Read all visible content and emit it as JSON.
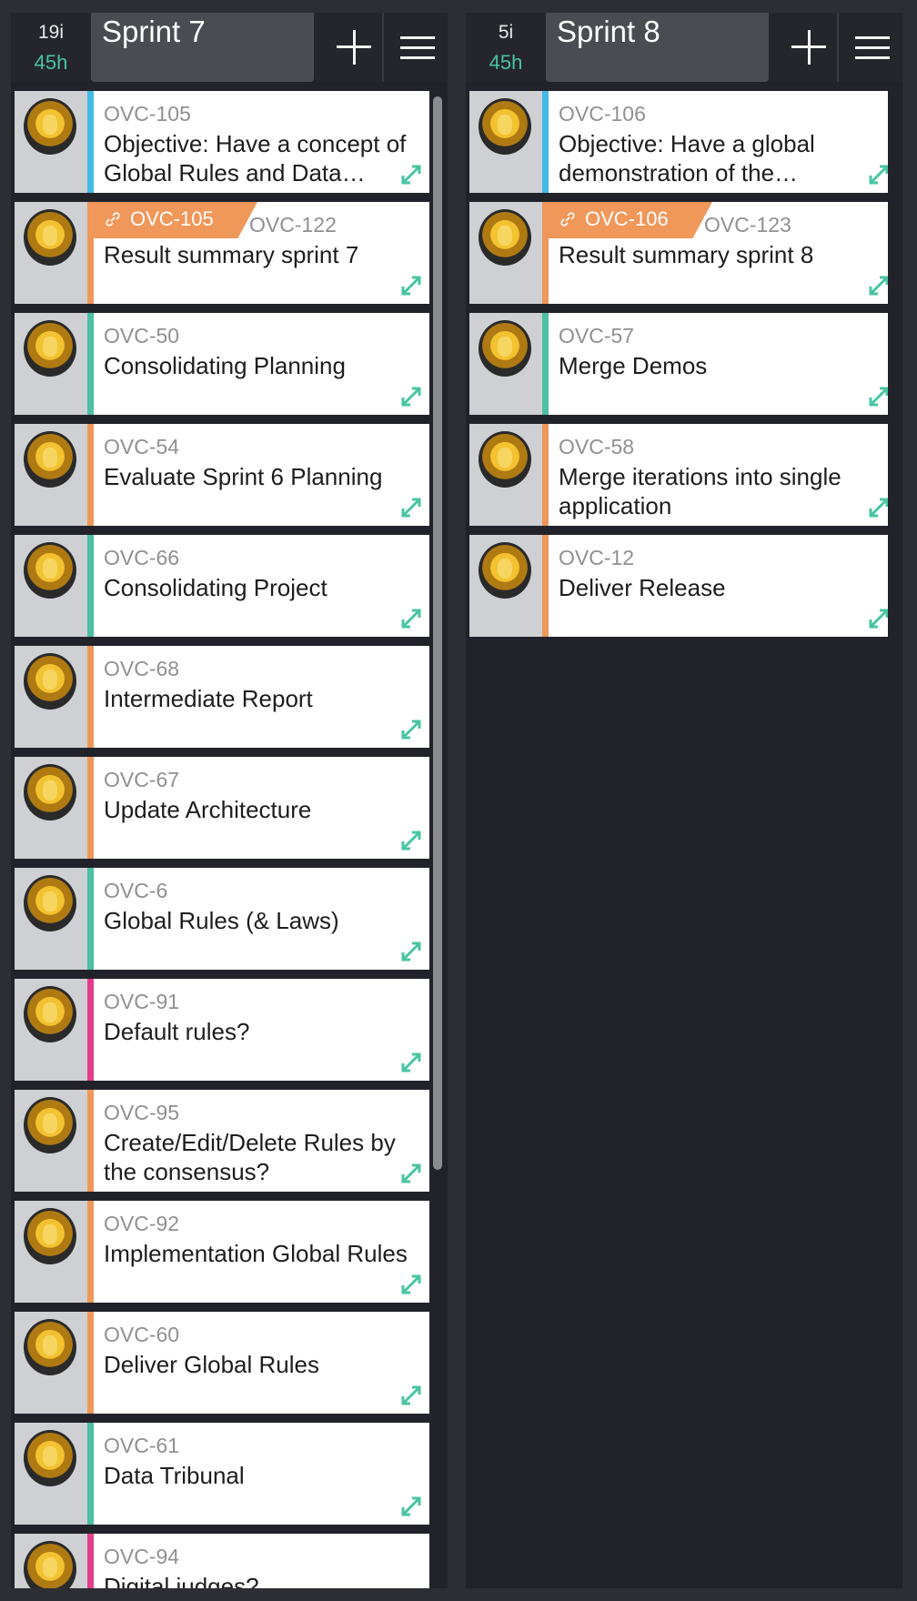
{
  "columns": [
    {
      "item_count": "19i",
      "hours": "45h",
      "title": "Sprint 7",
      "cards": [
        {
          "key": "OVC-105",
          "summary": "Objective: Have a concept of Global Rules and Data…",
          "stripe": "#44b9e6"
        },
        {
          "parent": "OVC-105",
          "key": "OVC-122",
          "summary": "Result summary sprint 7",
          "stripe": "#f0975a"
        },
        {
          "key": "OVC-50",
          "summary": "Consolidating Planning",
          "stripe": "#4dbfa3"
        },
        {
          "key": "OVC-54",
          "summary": "Evaluate Sprint 6 Planning",
          "stripe": "#f0975a"
        },
        {
          "key": "OVC-66",
          "summary": "Consolidating Project",
          "stripe": "#4dbfa3"
        },
        {
          "key": "OVC-68",
          "summary": "Intermediate Report",
          "stripe": "#f0975a"
        },
        {
          "key": "OVC-67",
          "summary": "Update Architecture",
          "stripe": "#f0975a"
        },
        {
          "key": "OVC-6",
          "summary": "Global Rules (& Laws)",
          "stripe": "#4dbfa3"
        },
        {
          "key": "OVC-91",
          "summary": "Default rules?",
          "stripe": "#e63c8a"
        },
        {
          "key": "OVC-95",
          "summary": "Create/Edit/Delete Rules by the consensus?",
          "stripe": "#f0975a"
        },
        {
          "key": "OVC-92",
          "summary": "Implementation Global Rules",
          "stripe": "#f0975a"
        },
        {
          "key": "OVC-60",
          "summary": "Deliver Global Rules",
          "stripe": "#f0975a"
        },
        {
          "key": "OVC-61",
          "summary": "Data Tribunal",
          "stripe": "#4dbfa3"
        },
        {
          "key": "OVC-94",
          "summary": "Digital judges?",
          "stripe": "#e63c8a"
        }
      ]
    },
    {
      "item_count": "5i",
      "hours": "45h",
      "title": "Sprint 8",
      "cards": [
        {
          "key": "OVC-106",
          "summary": "Objective: Have a global demonstration of the…",
          "stripe": "#44b9e6"
        },
        {
          "parent": "OVC-106",
          "key": "OVC-123",
          "summary": "Result summary sprint 8",
          "stripe": "#f0975a"
        },
        {
          "key": "OVC-57",
          "summary": "Merge Demos",
          "stripe": "#4dbfa3"
        },
        {
          "key": "OVC-58",
          "summary": "Merge iterations into single application",
          "stripe": "#f0975a"
        },
        {
          "key": "OVC-12",
          "summary": "Deliver Release",
          "stripe": "#f0975a"
        }
      ]
    }
  ],
  "icons": {
    "add": "plus-icon",
    "menu": "hamburger-menu-icon",
    "expand": "expand-arrows-icon",
    "link": "link-icon",
    "avatar": "user-avatar"
  },
  "colors": {
    "background": "#2d2e34",
    "hours": "#49c4a2",
    "parent_tag": "#f0975a",
    "expand_icon": "#49c4a2"
  }
}
